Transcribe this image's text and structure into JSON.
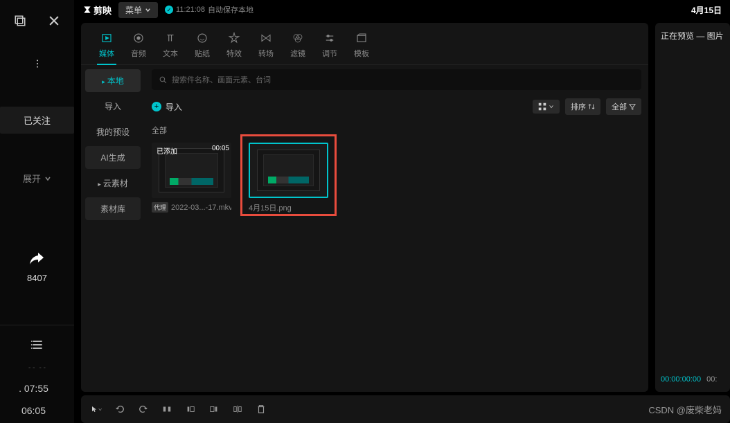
{
  "leftbar": {
    "followed": "已关注",
    "expand": "展开",
    "share_count": "8407",
    "times": [
      "07:55",
      "06:05"
    ]
  },
  "titlebar": {
    "logo": "剪映",
    "menu": "菜单",
    "autosave_time": "11:21:08",
    "autosave_text": "自动保存本地",
    "date": "4月15日"
  },
  "tabs": [
    {
      "label": "媒体"
    },
    {
      "label": "音频"
    },
    {
      "label": "文本"
    },
    {
      "label": "贴纸"
    },
    {
      "label": "特效"
    },
    {
      "label": "转场"
    },
    {
      "label": "滤镜"
    },
    {
      "label": "调节"
    },
    {
      "label": "模板"
    }
  ],
  "sidenav": [
    {
      "label": "本地",
      "active": true,
      "arrow": true
    },
    {
      "label": "导入"
    },
    {
      "label": "我的预设"
    },
    {
      "label": "AI生成"
    },
    {
      "label": "云素材",
      "arrow": true
    },
    {
      "label": "素材库"
    }
  ],
  "search_placeholder": "搜索件名称、画面元素、台词",
  "import_label": "导入",
  "controls": {
    "sort": "排序",
    "all": "全部"
  },
  "section_all": "全部",
  "media": [
    {
      "tag": "已添加",
      "time": "00:05",
      "badge": "代理",
      "name": "2022-03...-17.mkv"
    },
    {
      "name": "4月15日.png"
    }
  ],
  "preview": {
    "title": "正在预览 — 图片",
    "time1": "00:00:00:00",
    "time2": "00:"
  },
  "watermark": "CSDN @废柴老妈"
}
